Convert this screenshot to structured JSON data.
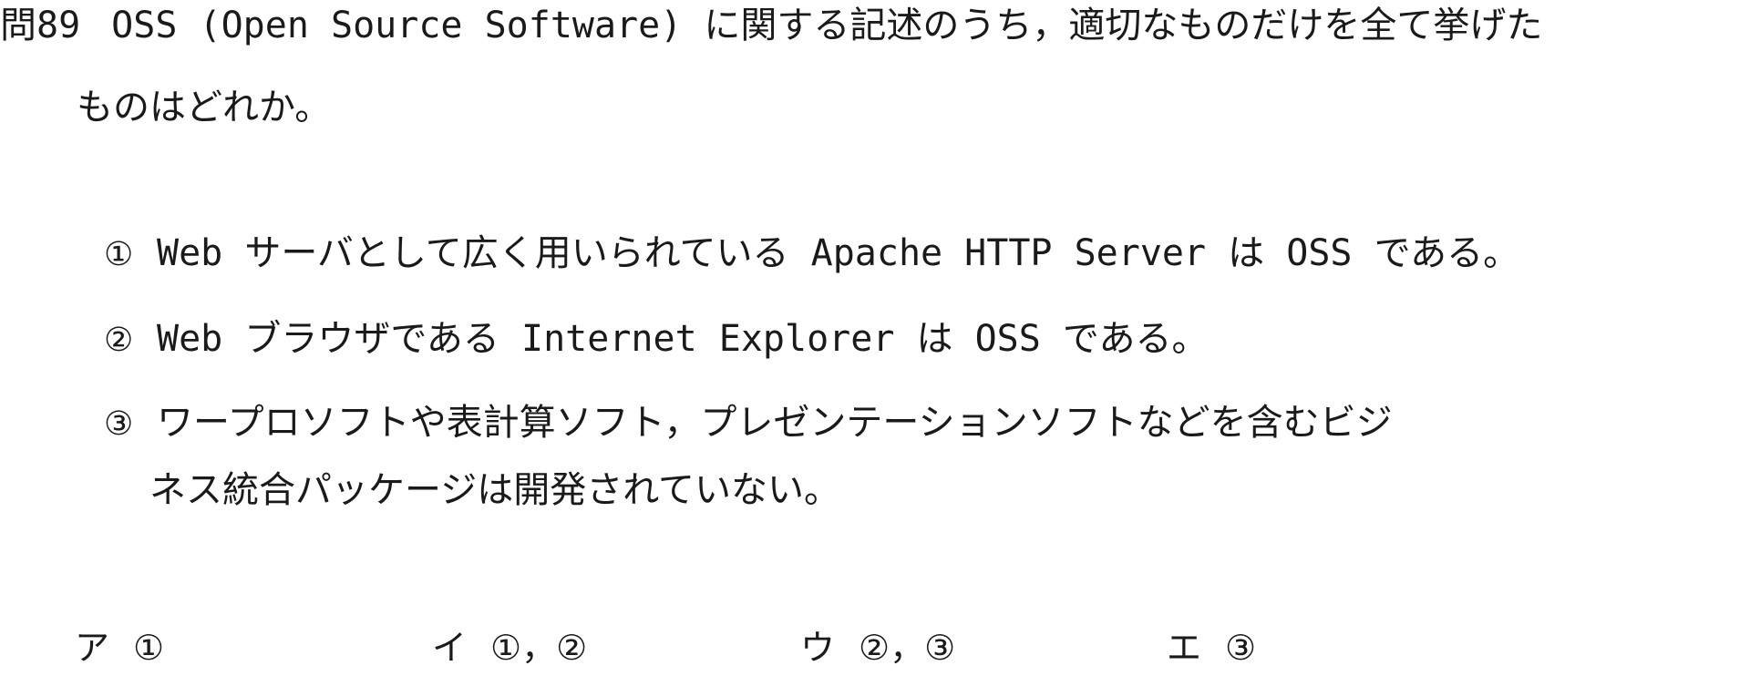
{
  "question": {
    "number": "問89",
    "text_line1": "OSS (Open Source Software) に関する記述のうち，適切なものだけを全て挙げた",
    "text_line2": "ものはどれか。"
  },
  "statements": [
    {
      "marker": "①",
      "text": "Web サーバとして広く用いられている Apache HTTP Server は OSS である。"
    },
    {
      "marker": "②",
      "text": "Web ブラウザである Internet Explorer は OSS である。"
    },
    {
      "marker": "③",
      "text": "ワープロソフトや表計算ソフト，プレゼンテーションソフトなどを含むビジ",
      "text_cont": "ネス統合パッケージは開発されていない。"
    }
  ],
  "choices": [
    {
      "label": "ア",
      "value": "①"
    },
    {
      "label": "イ",
      "value": "①，②"
    },
    {
      "label": "ウ",
      "value": "②，③"
    },
    {
      "label": "エ",
      "value": "③"
    }
  ]
}
